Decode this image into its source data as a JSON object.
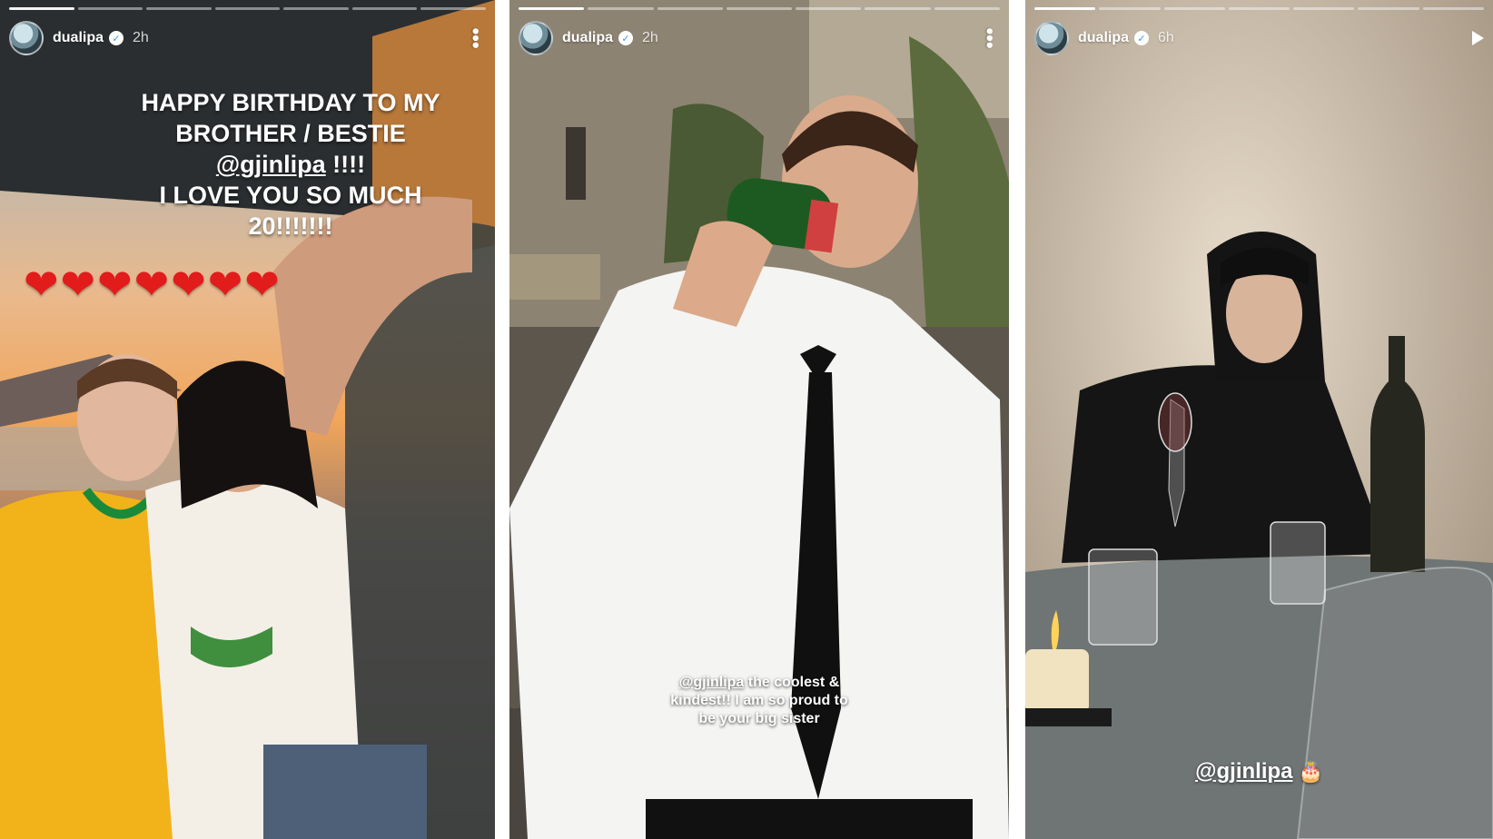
{
  "stories": [
    {
      "username": "dualipa",
      "verified_mark": "✓",
      "time": "2h",
      "caption_line1": "HAPPY BIRTHDAY TO MY",
      "caption_line2": "BROTHER / BESTIE",
      "caption_mention": "@gjinlipa",
      "caption_mention_suffix": " !!!!",
      "caption_line4": "I LOVE YOU SO MUCH",
      "caption_line5": "20!!!!!!!",
      "hearts": [
        "❤",
        "❤",
        "❤",
        "❤",
        "❤",
        "❤",
        "❤"
      ],
      "progress_total": 7,
      "progress_current": 1
    },
    {
      "username": "dualipa",
      "verified_mark": "✓",
      "time": "2h",
      "caption_mention": "@gjinlipa",
      "caption_line1_rest": " the coolest &",
      "caption_line2": "kindest!! I am so proud to",
      "caption_line3": "be your big sister",
      "progress_total": 7,
      "progress_current": 1
    },
    {
      "username": "dualipa",
      "verified_mark": "✓",
      "time": "6h",
      "caption_mention": "@gjinlipa",
      "caption_emoji": "🎂",
      "progress_total": 7,
      "progress_current": 1
    }
  ],
  "icons": {
    "more": "more-options-icon",
    "play": "play-icon",
    "verified": "verified-badge-icon"
  },
  "colors": {
    "heart": "#e21b1b",
    "verified": "#3897f0"
  }
}
